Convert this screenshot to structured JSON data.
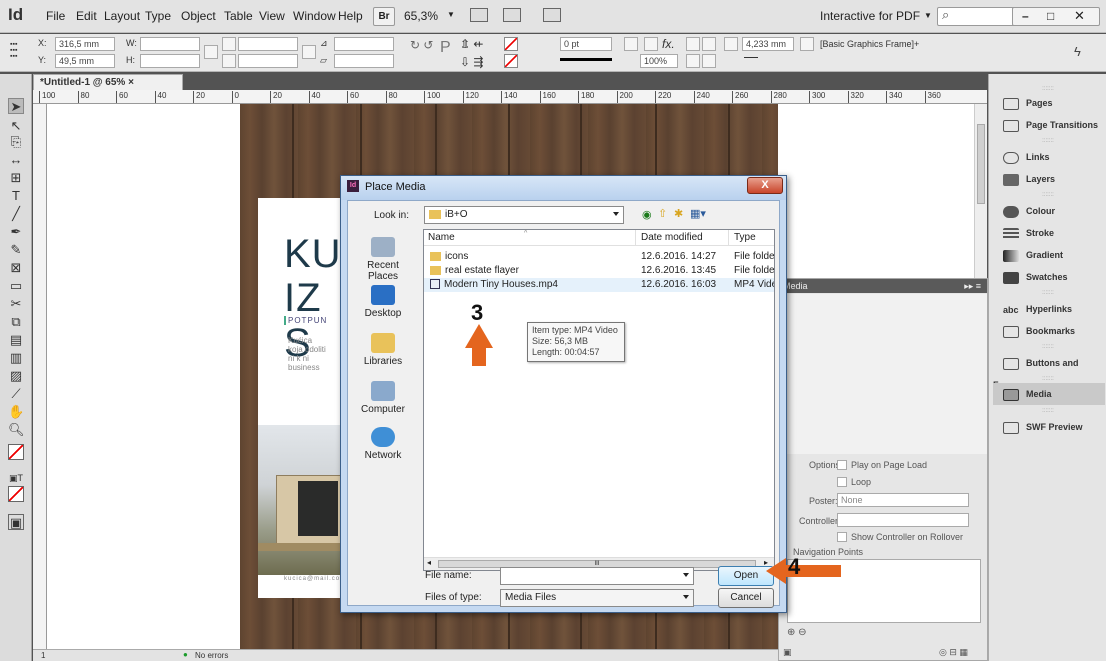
{
  "menubar": {
    "logo": "Id",
    "items": [
      "File",
      "Edit",
      "Layout",
      "Type",
      "Object",
      "Table",
      "View",
      "Window",
      "Help"
    ],
    "bridge": "Br",
    "zoom": "65,3%",
    "workspace": "Interactive for PDF"
  },
  "control": {
    "x_label": "X:",
    "x_value": "316,5 mm",
    "y_label": "Y:",
    "y_value": "49,5 mm",
    "w_label": "W:",
    "h_label": "H:",
    "stroke_weight": "0 pt",
    "opacity": "100%",
    "gutter": "4,233 mm",
    "frame_style": "[Basic Graphics Frame]+"
  },
  "document": {
    "tab_title": "*Untitled-1 @ 65%",
    "ruler_ticks": [
      "100",
      "80",
      "60",
      "40",
      "20",
      "0",
      "20",
      "40",
      "60",
      "80",
      "100",
      "120",
      "140",
      "160",
      "180",
      "200",
      "220",
      "240",
      "260",
      "280",
      "300",
      "320",
      "340",
      "360"
    ],
    "flyer_heading_1": "KUĆ",
    "flyer_heading_2": "IZ S",
    "flyer_subtitle": "POTPUN",
    "flyer_body": "Kućica koja odoliti ni k ni business",
    "flyer_email": "kucica@mail.com",
    "status_page": "1",
    "status_errors": "No errors"
  },
  "dialog": {
    "title": "Place Media",
    "close": "X",
    "look_in_label": "Look in:",
    "look_in_value": "iB+O",
    "places": [
      "Recent Places",
      "Desktop",
      "Libraries",
      "Computer",
      "Network"
    ],
    "columns": {
      "name": "Name",
      "date": "Date modified",
      "type": "Type"
    },
    "files": [
      {
        "name": "icons",
        "date": "12.6.2016. 14:27",
        "type": "File folder"
      },
      {
        "name": "real estate flayer",
        "date": "12.6.2016. 13:45",
        "type": "File folder"
      },
      {
        "name": "Modern Tiny Houses.mp4",
        "date": "12.6.2016. 16:03",
        "type": "MP4 Video"
      }
    ],
    "tooltip": {
      "line1": "Item type: MP4 Video",
      "line2": "Size: 56,3 MB",
      "line3": "Length: 00:04:57"
    },
    "file_name_label": "File name:",
    "file_name_value": "",
    "file_type_label": "Files of type:",
    "file_type_value": "Media Files",
    "open": "Open",
    "cancel": "Cancel",
    "hscroll_grip": "III"
  },
  "annotations": {
    "step3": "3",
    "step4": "4"
  },
  "right_panel": {
    "items": [
      "Pages",
      "Page Transitions",
      "Links",
      "Layers",
      "Colour",
      "Stroke",
      "Gradient",
      "Swatches",
      "Hyperlinks",
      "Bookmarks",
      "Buttons and Forms",
      "Media",
      "SWF Preview"
    ]
  },
  "media_panel": {
    "tab": "Media",
    "options_label": "Options:",
    "play_on_load": "Play on Page Load",
    "loop": "Loop",
    "poster_label": "Poster:",
    "poster_value": "None",
    "controller_label": "Controller:",
    "show_controller": "Show Controller on Rollover",
    "nav_points": "Navigation Points"
  },
  "colors": {
    "accent_arrow": "#e4651e",
    "dialog_frame": "#c5d9f1",
    "selection": "#cce8ff"
  }
}
